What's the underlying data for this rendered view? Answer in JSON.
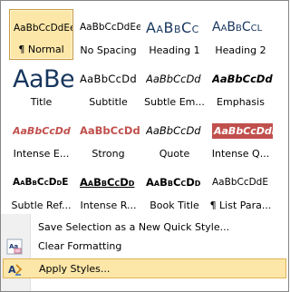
{
  "gallery": {
    "styles": [
      {
        "sample": "AaBbCcDdEe",
        "label": "¶ Normal",
        "selected": true
      },
      {
        "sample": "AaBbCcDdEe",
        "label": "No Spacing"
      },
      {
        "sample": "AaBbCc",
        "label": "Heading 1"
      },
      {
        "sample": "AaBbCcl",
        "label": "Heading 2"
      },
      {
        "sample": "AaBe",
        "label": "Title"
      },
      {
        "sample": "AaBbCcDd",
        "label": "Subtitle"
      },
      {
        "sample": "AaBbCcDd",
        "label": "Subtle Em..."
      },
      {
        "sample": "AaBbCcDd",
        "label": "Emphasis"
      },
      {
        "sample": "AaBbCcDd",
        "label": "Intense E..."
      },
      {
        "sample": "AaBbCcDd",
        "label": "Strong"
      },
      {
        "sample": "AaBbCcDd",
        "label": "Quote"
      },
      {
        "sample": "AaBbCcDdE",
        "label": "Intense Q..."
      },
      {
        "sample": "AaBbCcDdE",
        "label": "Subtle Ref..."
      },
      {
        "sample": "AaBbCcDd",
        "label": "Intense R..."
      },
      {
        "sample": "AaBbCcDd",
        "label": "Book Title"
      },
      {
        "sample": "AaBbCcDdE",
        "label": "¶ List Para..."
      }
    ]
  },
  "menu": {
    "save_selection": "Save Selection as a New Quick Style...",
    "clear_formatting": "Clear Formatting",
    "apply_styles": "Apply Styles..."
  },
  "colors": {
    "heading": "#17365d",
    "accent_red": "#c0504d",
    "selection_fill": "#fde7a8",
    "selection_border": "#c59a45"
  },
  "icons": {
    "save_selection": "new-style-icon",
    "clear_formatting": "clear-formatting-icon",
    "apply_styles": "apply-styles-icon"
  }
}
